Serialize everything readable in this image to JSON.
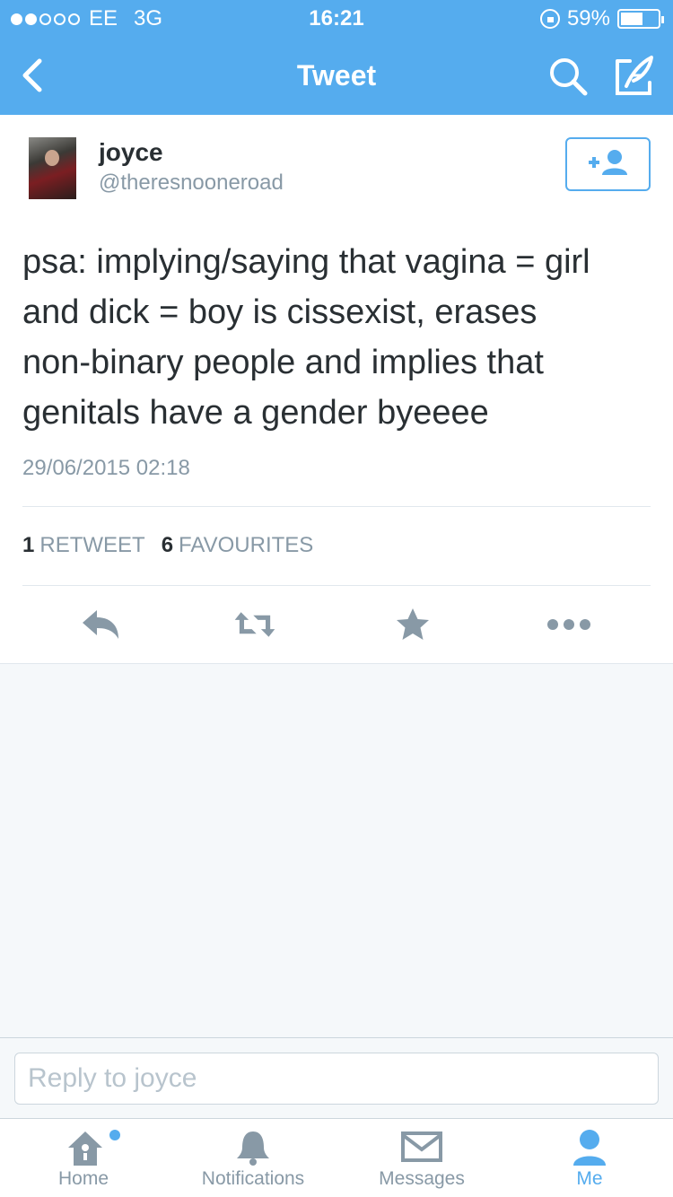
{
  "status_bar": {
    "carrier": "EE",
    "network": "3G",
    "time": "16:21",
    "battery": "59%",
    "signal_bars_filled": 2,
    "signal_bars_total": 5,
    "battery_level": 0.59
  },
  "nav": {
    "title": "Tweet",
    "back_icon": "chevron-left-icon",
    "search_icon": "search-icon",
    "compose_icon": "compose-icon"
  },
  "tweet": {
    "author_name": "joyce",
    "author_handle": "@theresnooneroad",
    "text_lines": [
      "psa: implying/saying that vagina = girl",
      "and dick = boy is cissexist, erases",
      "non-binary people and implies that",
      "genitals have a gender byeeee"
    ],
    "timestamp": "29/06/2015 02:18",
    "retweet_count": "1",
    "retweet_label": "RETWEET",
    "favourite_count": "6",
    "favourite_label": "FAVOURITES"
  },
  "reply": {
    "placeholder": "Reply to joyce",
    "value": ""
  },
  "tabs": [
    {
      "label": "Home",
      "icon": "home-icon"
    },
    {
      "label": "Notifications",
      "icon": "bell-icon"
    },
    {
      "label": "Messages",
      "icon": "envelope-icon"
    },
    {
      "label": "Me",
      "icon": "person-icon"
    }
  ],
  "active_tab": "Me",
  "colors": {
    "brand": "#55acee",
    "icon_gray": "#8899a6",
    "text": "#292f33",
    "background": "#f5f8fa"
  }
}
